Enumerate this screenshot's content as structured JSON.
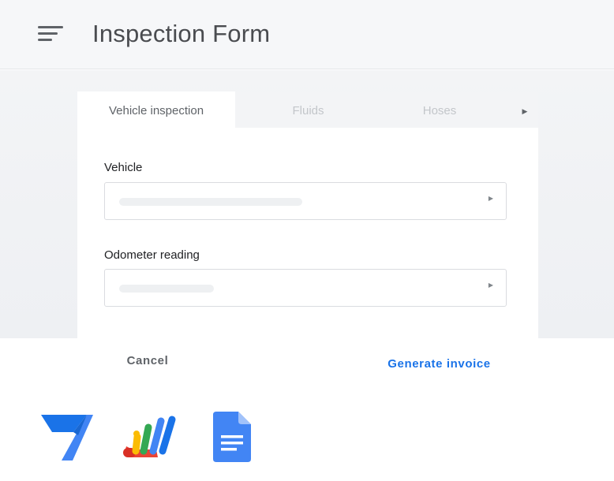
{
  "app": {
    "title": "Inspection Form",
    "menu_icon": "menu-icon"
  },
  "tabs": [
    {
      "label": "Vehicle inspection",
      "active": true
    },
    {
      "label": "Fluids",
      "active": false
    },
    {
      "label": "Hoses",
      "active": false
    }
  ],
  "tabs_scroll_icon": "chevron-right-icon",
  "form": {
    "fields": [
      {
        "label": "Vehicle",
        "value": "",
        "icon": "chevron-right-icon"
      },
      {
        "label": "Odometer reading",
        "value": "",
        "icon": "chevron-right-icon"
      }
    ]
  },
  "actions": {
    "cancel_label": "Cancel",
    "generate_label": "Generate invoice"
  },
  "logos": [
    {
      "icon": "appsheet-logo-icon"
    },
    {
      "icon": "apps-script-logo-icon"
    },
    {
      "icon": "google-docs-logo-icon"
    }
  ],
  "colors": {
    "accent": "#1a73e8",
    "appbar_bg": "#f6f7f9",
    "title_text": "#4a4c50"
  }
}
